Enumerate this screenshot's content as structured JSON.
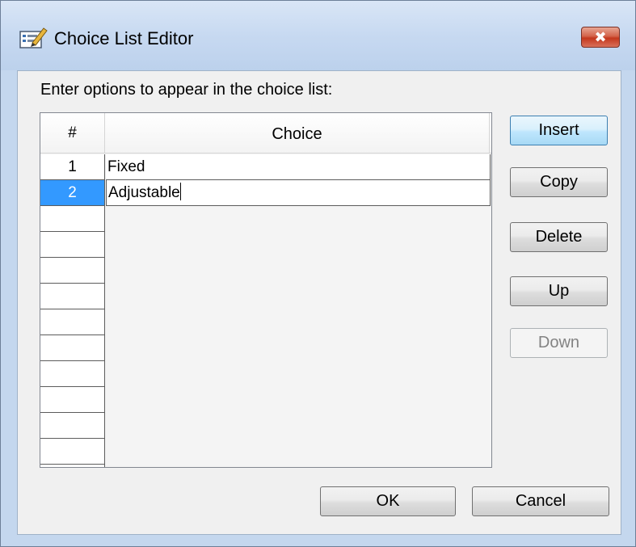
{
  "window": {
    "title": "Choice List Editor",
    "icon": "choice-list-editor-icon",
    "close_label": "✖"
  },
  "prompt": "Enter options to appear in the choice list:",
  "grid": {
    "headers": {
      "number": "#",
      "choice": "Choice"
    },
    "rows": [
      {
        "number": "1",
        "choice": "Fixed",
        "selected": false
      },
      {
        "number": "2",
        "choice": "Adjustable",
        "selected": true,
        "editing": true
      }
    ],
    "empty_rows": 10
  },
  "side_buttons": {
    "insert": "Insert",
    "copy": "Copy",
    "delete": "Delete",
    "up": "Up",
    "down": "Down"
  },
  "footer_buttons": {
    "ok": "OK",
    "cancel": "Cancel"
  },
  "colors": {
    "selection": "#3399ff",
    "titlebar": "#c4d7ee",
    "close_button": "#c4371c"
  }
}
